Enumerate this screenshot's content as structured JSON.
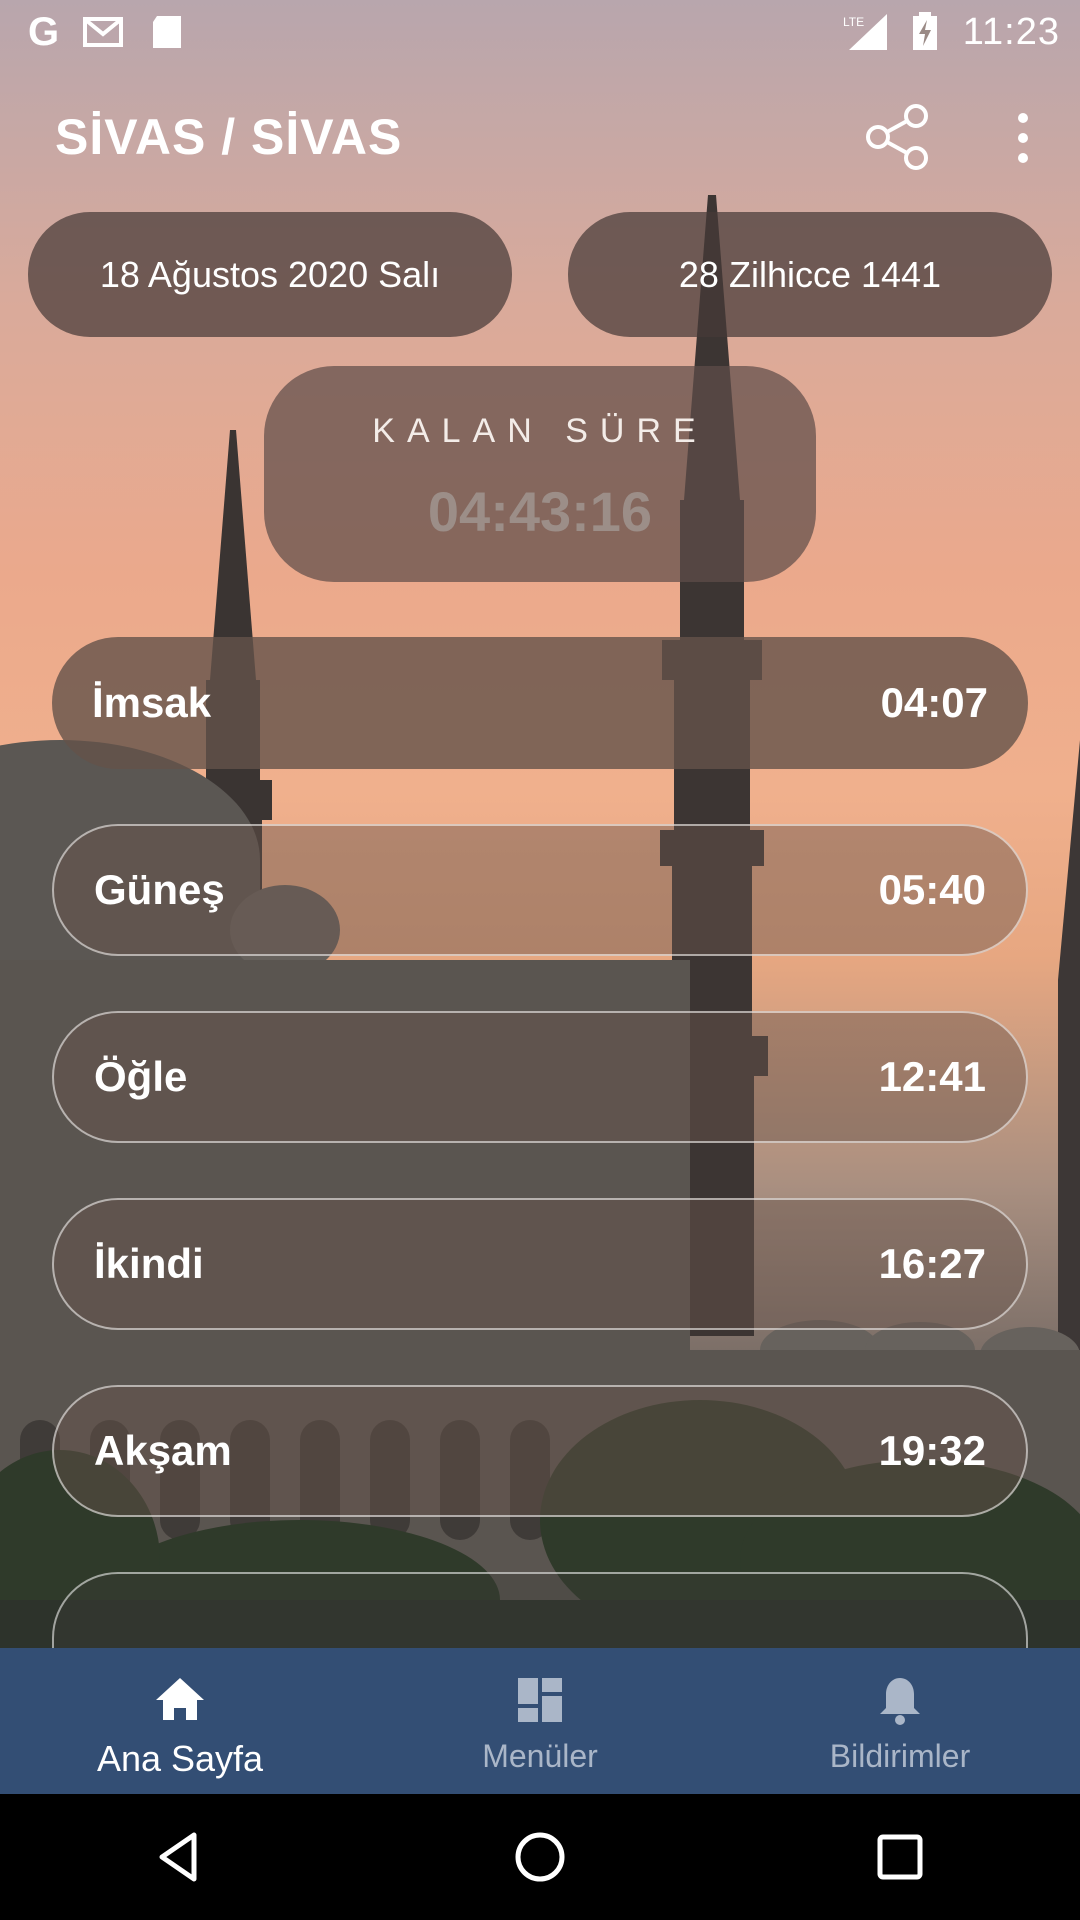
{
  "status_bar": {
    "left_icons": [
      "google-g-icon",
      "gmail-icon",
      "sd-card-icon"
    ],
    "network": "LTE",
    "time": "11:23"
  },
  "app_bar": {
    "title": "SİVAS / SİVAS",
    "share_icon": "share-icon",
    "more_icon": "more-vertical-icon"
  },
  "dates": {
    "gregorian": "18 Ağustos 2020 Salı",
    "hijri": "28 Zilhicce 1441"
  },
  "countdown": {
    "label": "KALAN SÜRE",
    "value": "04:43:16"
  },
  "prayers": [
    {
      "name": "İmsak",
      "time": "04:07"
    },
    {
      "name": "Güneş",
      "time": "05:40"
    },
    {
      "name": "Öğle",
      "time": "12:41"
    },
    {
      "name": "İkindi",
      "time": "16:27"
    },
    {
      "name": "Akşam",
      "time": "19:32"
    }
  ],
  "bottom_nav": [
    {
      "label": "Ana Sayfa",
      "icon": "home-icon",
      "active": true
    },
    {
      "label": "Menüler",
      "icon": "dashboard-icon",
      "active": false
    },
    {
      "label": "Bildirimler",
      "icon": "bell-icon",
      "active": false
    }
  ],
  "colors": {
    "bottom_nav_bg": "#334e74",
    "pill_bg": "#463a37"
  }
}
